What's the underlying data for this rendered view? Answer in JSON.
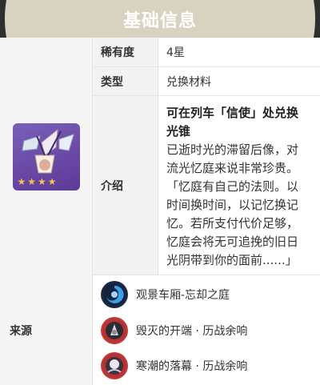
{
  "header": {
    "title": "基础信息"
  },
  "rows": {
    "rarity": {
      "label": "稀有度",
      "value": "4星"
    },
    "type": {
      "label": "类型",
      "value": "兑换材料"
    },
    "intro": {
      "label": "介绍",
      "title_lines": [
        "可在列车「信使」处兑换",
        "光锥"
      ],
      "body_lines": [
        "已逝时光的滞留后像，对",
        "流光忆庭来说非常珍贵。",
        "「忆庭有自己的法则。以",
        "时间换时间，以记忆换记",
        "忆。若所支付代价足够，",
        "忆庭会将无可追挽的旧日",
        "光阴带到你的面前......」"
      ]
    }
  },
  "source": {
    "label": "来源",
    "items": [
      {
        "text": "观景车厢-忘却之庭",
        "icon": "memory-swirl-icon"
      },
      {
        "text": "毁灭的开端 · 历战余响",
        "icon": "destruction-boss-icon"
      },
      {
        "text": "寒潮的落幕 · 历战余响",
        "icon": "cocolia-boss-icon"
      }
    ]
  },
  "item_card": {
    "stars": 4,
    "icon": "shattered-lens-icon"
  },
  "colors": {
    "header_bg": "#d8d2c1",
    "card_bg": "#6a4aa6",
    "star": "#f3c34a"
  }
}
